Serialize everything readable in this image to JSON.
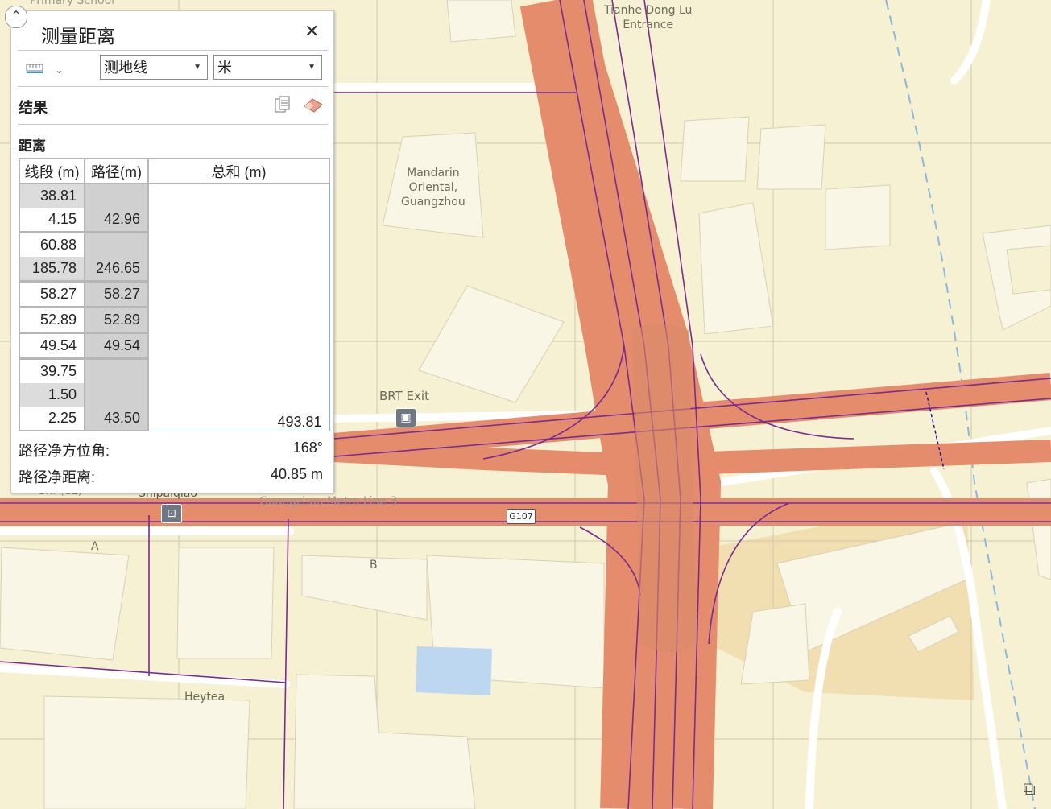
{
  "panel": {
    "title": "测量距离",
    "close_icon": "close-icon",
    "tool_icon": "ruler-icon",
    "mode_select": "测地线",
    "unit_select": "米",
    "results_heading": "结果",
    "distance_heading": "距离",
    "columns": [
      "线段 (m)",
      "路径(m)",
      "总和 (m)"
    ],
    "rows": [
      {
        "segment": "38.81",
        "path": ""
      },
      {
        "segment": "4.15",
        "path": "42.96"
      },
      {
        "segment": "60.88",
        "path": ""
      },
      {
        "segment": "185.78",
        "path": "246.65"
      },
      {
        "segment": "58.27",
        "path": "58.27"
      },
      {
        "segment": "52.89",
        "path": "52.89"
      },
      {
        "segment": "49.54",
        "path": "49.54"
      },
      {
        "segment": "39.75",
        "path": ""
      },
      {
        "segment": "1.50",
        "path": ""
      },
      {
        "segment": "2.25",
        "path": "43.50"
      }
    ],
    "total": "493.81",
    "bearing_label": "路径净方位角:",
    "bearing_value": "168°",
    "net_distance_label": "路径净距离:",
    "net_distance_value": "40.85 m"
  },
  "map_labels": {
    "tianhe": "Tianhe Dong Lu\nEntrance",
    "mandarin": "Mandarin\nOriental,\nGuangzhou",
    "brt_exit": "BRT Exit",
    "metro_line": "Guangzhou Metro Line 3",
    "shipaiqiao": "Shipaiqiao",
    "school": "Primary School",
    "heytea": "Heytea",
    "exit_a": "A",
    "exit_b": "B",
    "brt_stop": "BRT (GZ)",
    "route_shield": "G107"
  },
  "colors": {
    "map_background": "#f6f1d3",
    "building": "#faf6e6",
    "highway": "#e48c6c",
    "route_line": "#7a2c91",
    "water": "#bcd7ef",
    "accent": "#7ab4da"
  }
}
